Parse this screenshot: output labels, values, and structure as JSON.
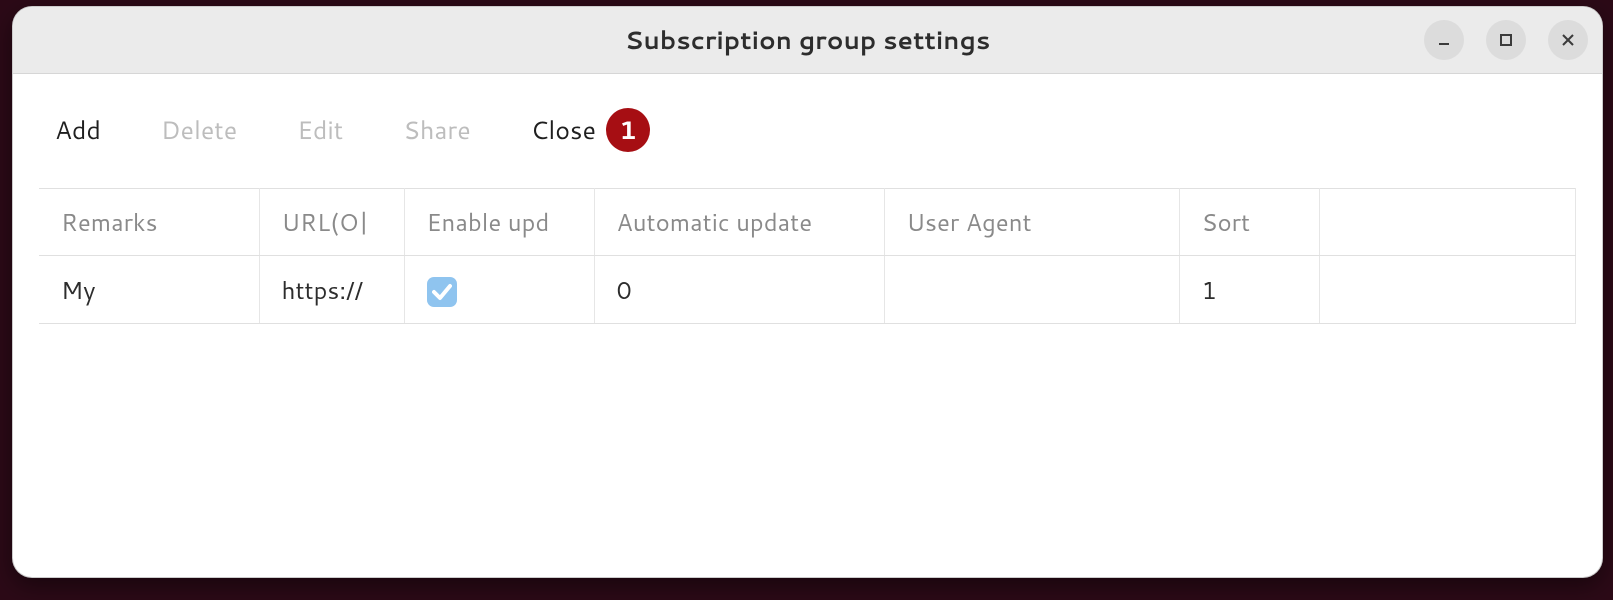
{
  "window": {
    "title": "Subscription group settings"
  },
  "toolbar": {
    "add": {
      "label": "Add",
      "enabled": true
    },
    "delete": {
      "label": "Delete",
      "enabled": false
    },
    "edit": {
      "label": "Edit",
      "enabled": false
    },
    "share": {
      "label": "Share",
      "enabled": false
    },
    "close": {
      "label": "Close",
      "enabled": true,
      "badge": "1"
    }
  },
  "table": {
    "headers": {
      "remarks": "Remarks",
      "url": "URL(O|",
      "enable": "Enable upd",
      "auto": "Automatic update",
      "ua": "User Agent",
      "sort": "Sort"
    },
    "rows": [
      {
        "remarks": "My",
        "url": "https://",
        "enable_checked": true,
        "auto": "0",
        "ua": "",
        "sort": "1"
      }
    ]
  }
}
